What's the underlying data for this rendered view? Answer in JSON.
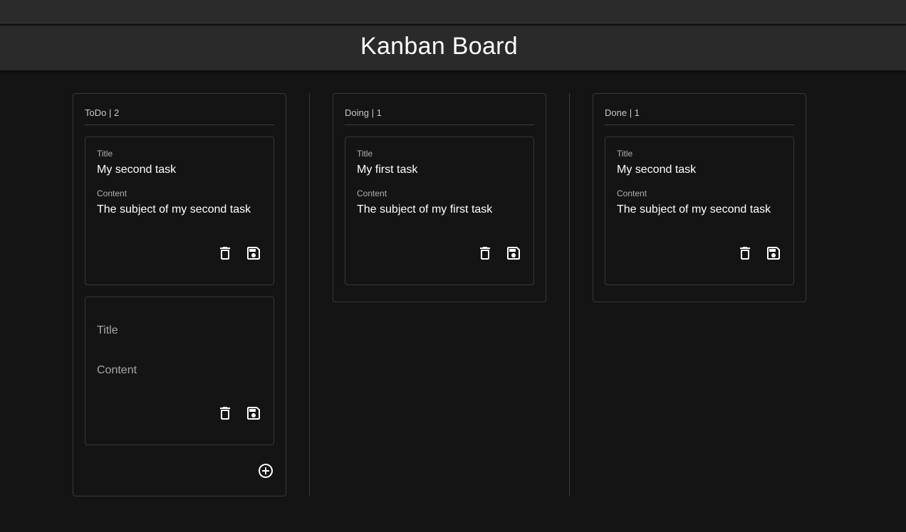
{
  "app": {
    "title": "Kanban Board"
  },
  "icons": {
    "delete": "trash-icon",
    "save": "save-icon",
    "add": "add-circle-icon"
  },
  "columns": [
    {
      "header": "ToDo | 2",
      "cards": [
        {
          "title_label": "Title",
          "title": "My second task",
          "content_label": "Content",
          "content": "The subject of my second task"
        },
        {
          "title_placeholder": "Title",
          "content_placeholder": "Content"
        }
      ]
    },
    {
      "header": "Doing | 1",
      "cards": [
        {
          "title_label": "Title",
          "title": "My first task",
          "content_label": "Content",
          "content": "The subject of my first task"
        }
      ]
    },
    {
      "header": "Done | 1",
      "cards": [
        {
          "title_label": "Title",
          "title": "My second task",
          "content_label": "Content",
          "content": "The subject of my second task"
        }
      ]
    }
  ]
}
